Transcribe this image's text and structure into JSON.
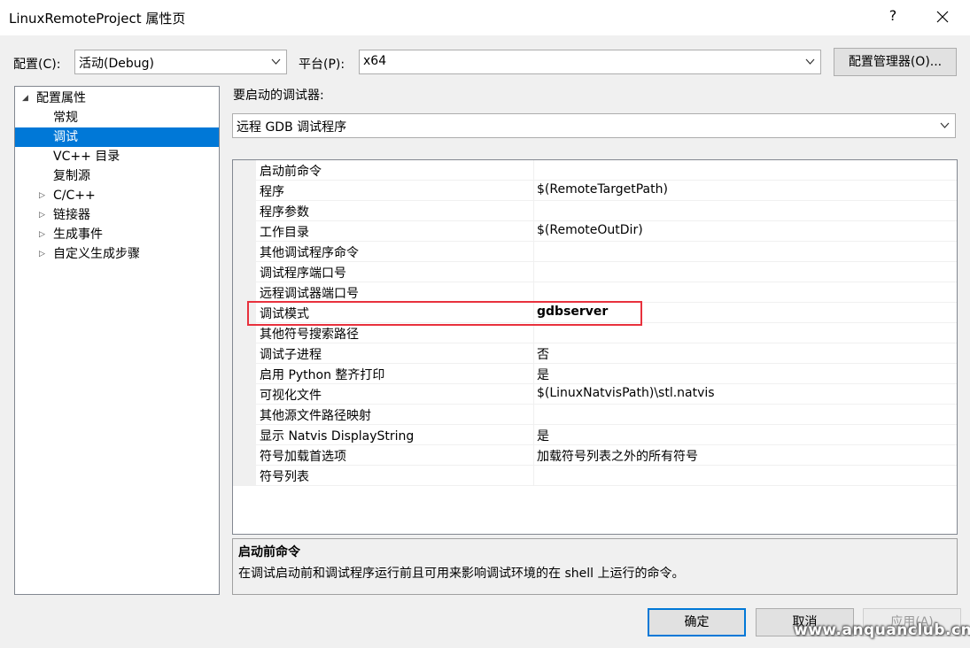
{
  "window": {
    "title": "LinuxRemoteProject 属性页",
    "help": "?"
  },
  "config_bar": {
    "config_label": "配置(C):",
    "config_value": "活动(Debug)",
    "platform_label": "平台(P):",
    "platform_value": "x64",
    "manager_button": "配置管理器(O)..."
  },
  "tree": {
    "root": "配置属性",
    "items": [
      "常规",
      "调试",
      "VC++ 目录",
      "复制源",
      "C/C++",
      "链接器",
      "生成事件",
      "自定义生成步骤"
    ],
    "selected": "调试"
  },
  "debugger": {
    "label": "要启动的调试器:",
    "value": "远程 GDB 调试程序"
  },
  "properties": [
    {
      "name": "启动前命令",
      "value": ""
    },
    {
      "name": "程序",
      "value": "$(RemoteTargetPath)"
    },
    {
      "name": "程序参数",
      "value": ""
    },
    {
      "name": "工作目录",
      "value": "$(RemoteOutDir)"
    },
    {
      "name": "其他调试程序命令",
      "value": ""
    },
    {
      "name": "调试程序端口号",
      "value": ""
    },
    {
      "name": "远程调试器端口号",
      "value": ""
    },
    {
      "name": "调试模式",
      "value": "gdbserver"
    },
    {
      "name": "其他符号搜索路径",
      "value": ""
    },
    {
      "name": "调试子进程",
      "value": "否"
    },
    {
      "name": "启用 Python 整齐打印",
      "value": "是"
    },
    {
      "name": "可视化文件",
      "value": "$(LinuxNatvisPath)\\stl.natvis"
    },
    {
      "name": "其他源文件路径映射",
      "value": ""
    },
    {
      "name": "显示 Natvis DisplayString",
      "value": "是"
    },
    {
      "name": "符号加载首选项",
      "value": "加载符号列表之外的所有符号"
    },
    {
      "name": "符号列表",
      "value": ""
    }
  ],
  "description": {
    "title": "启动前命令",
    "text": "在调试启动前和调试程序运行前且可用来影响调试环境的在 shell 上运行的命令。"
  },
  "buttons": {
    "ok": "确定",
    "cancel": "取消",
    "apply": "应用(A)"
  },
  "watermark": "www.anquanclub.cn",
  "colors": {
    "selection": "#0078d7",
    "highlight_box": "#e8313d"
  }
}
